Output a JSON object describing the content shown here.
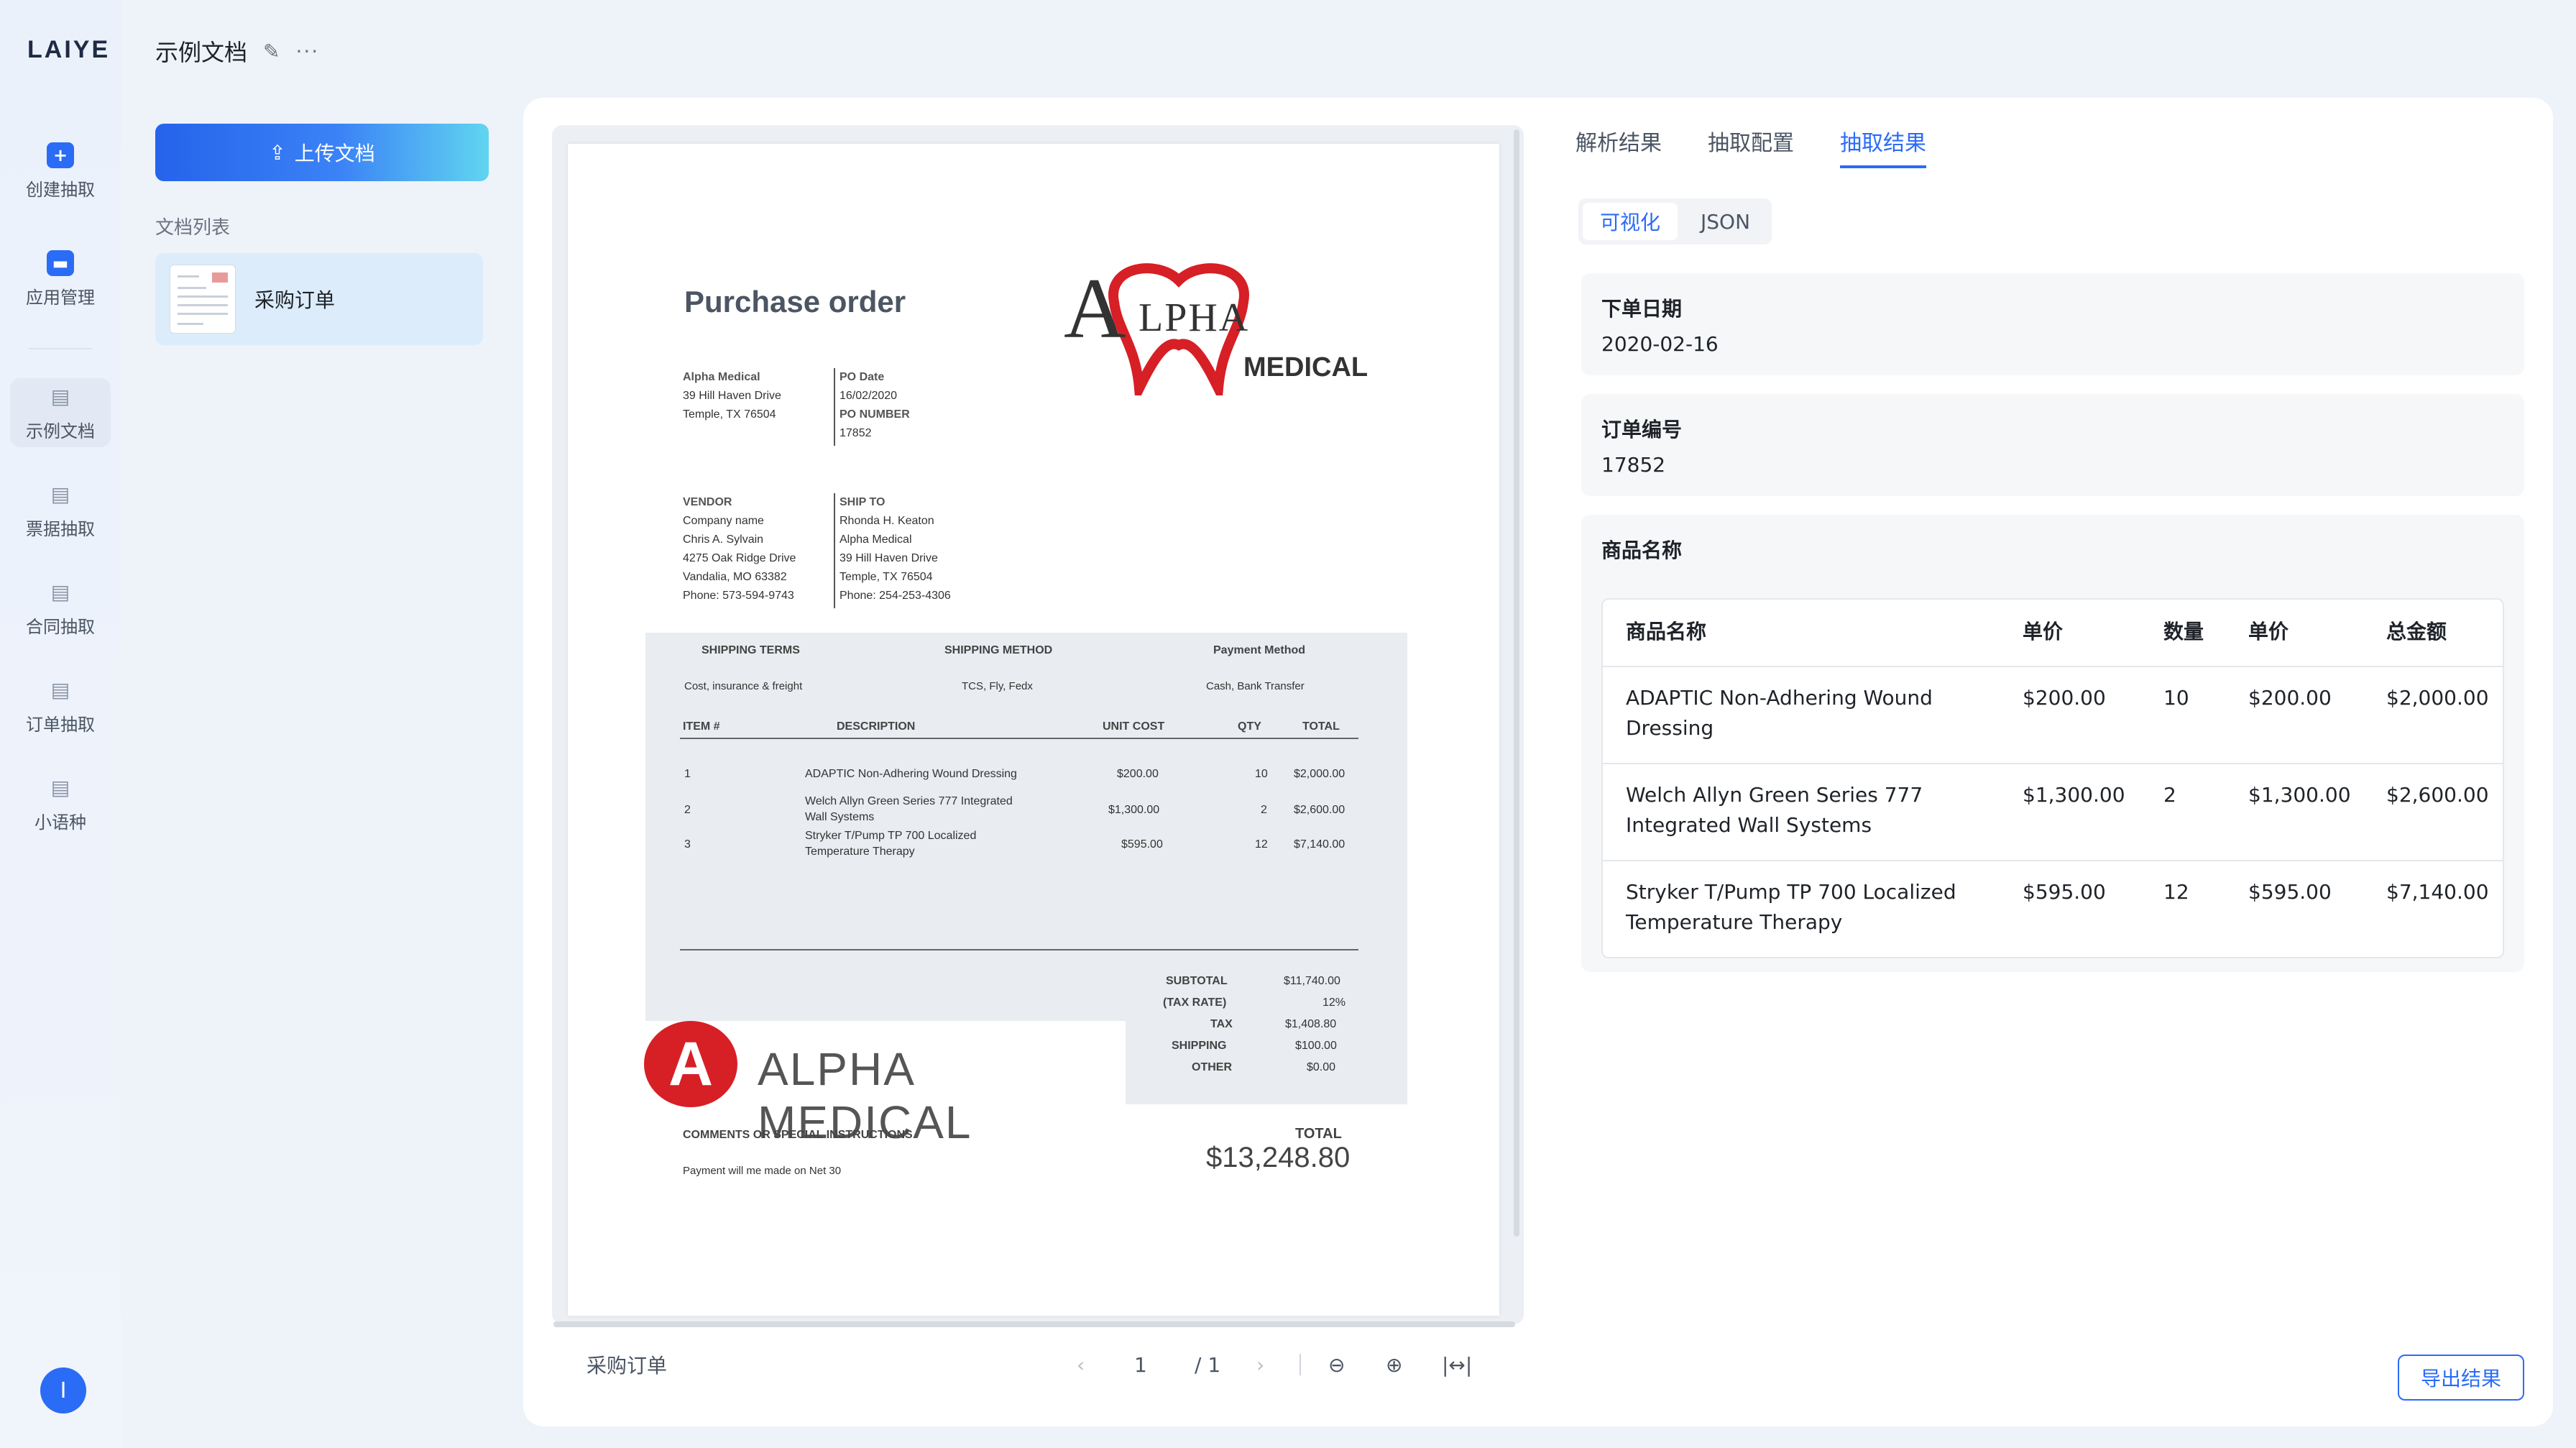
{
  "app": {
    "logo": "LAIYE"
  },
  "rail": {
    "items": [
      {
        "label": "创建抽取"
      },
      {
        "label": "应用管理"
      },
      {
        "label": "示例文档"
      },
      {
        "label": "票据抽取"
      },
      {
        "label": "合同抽取"
      },
      {
        "label": "订单抽取"
      },
      {
        "label": "小语种"
      }
    ],
    "avatar": "I"
  },
  "docpanel": {
    "title": "示例文档",
    "edit_icon": "✎",
    "more_icon": "···",
    "upload_label": "上传文档",
    "upload_icon": "⇪",
    "list_label": "文档列表",
    "items": [
      {
        "name": "采购订单"
      }
    ]
  },
  "viewer": {
    "doc_name": "采购订单",
    "prev": "‹",
    "page": "1",
    "total": "/ 1",
    "next": "›",
    "zoom_out": "⊖",
    "zoom_in": "⊕",
    "fit": "|↔|"
  },
  "po": {
    "title": "Purchase order",
    "logo_letter": "A",
    "logo_rest": "LPHA",
    "logo_sub": "MEDICAL",
    "from": [
      "Alpha Medical",
      "39 Hill Haven Drive",
      "Temple, TX 76504"
    ],
    "po_date_label": "PO Date",
    "po_date": "16/02/2020",
    "po_number_label": "PO NUMBER",
    "po_number": "17852",
    "vendor_label": "VENDOR",
    "vendor": [
      "Company name",
      "Chris A. Sylvain",
      "4275 Oak Ridge Drive",
      "Vandalia, MO 63382",
      "Phone: 573-594-9743"
    ],
    "ship_label": "SHIP TO",
    "ship": [
      "Rhonda H. Keaton",
      "Alpha Medical",
      "39 Hill Haven Drive",
      "Temple, TX 76504",
      "Phone: 254-253-4306"
    ],
    "shipping_terms_label": "SHIPPING TERMS",
    "shipping_terms": "Cost, insurance & freight",
    "shipping_method_label": "SHIPPING METHOD",
    "shipping_method": "TCS, Fly, Fedx",
    "payment_method_label": "Payment Method",
    "payment_method": "Cash, Bank Transfer",
    "col_item": "ITEM #",
    "col_desc": "DESCRIPTION",
    "col_unit": "UNIT COST",
    "col_qty": "QTY",
    "col_total": "TOTAL",
    "lines": [
      {
        "item": "1",
        "desc1": "ADAPTIC Non-Adhering Wound Dressing",
        "desc2": "",
        "unit": "$200.00",
        "qty": "10",
        "total": "$2,000.00"
      },
      {
        "item": "2",
        "desc1": "Welch Allyn Green Series 777 Integrated",
        "desc2": "Wall Systems",
        "unit": "$1,300.00",
        "qty": "2",
        "total": "$2,600.00"
      },
      {
        "item": "3",
        "desc1": "Stryker T/Pump TP 700 Localized",
        "desc2": "Temperature Therapy",
        "unit": "$595.00",
        "qty": "12",
        "total": "$7,140.00"
      }
    ],
    "subtotal_label": "SUBTOTAL",
    "subtotal": "$11,740.00",
    "taxrate_label": "(TAX RATE)",
    "taxrate": "12%",
    "tax_label": "TAX",
    "tax": "$1,408.80",
    "shipping_label": "SHIPPING",
    "shipping": "$100.00",
    "other_label": "OTHER",
    "other": "$0.00",
    "logo2_letter": "A",
    "logo2_text": "ALPHA MEDICAL",
    "comments_label": "COMMENTS OR SPECIAL INSTRUCTIONS",
    "comments": "Payment will me made on Net 30",
    "total_label": "TOTAL",
    "total": "$13,248.80"
  },
  "result": {
    "tabs": [
      "解析结果",
      "抽取配置",
      "抽取结果"
    ],
    "views": [
      "可视化",
      "JSON"
    ],
    "order_date_label": "下单日期",
    "order_date": "2020-02-16",
    "order_no_label": "订单编号",
    "order_no": "17852",
    "goods_label": "商品名称",
    "headers": [
      "商品名称",
      "单价",
      "数量",
      "单价",
      "总金额"
    ],
    "rows": [
      [
        "ADAPTIC Non-Adhering Wound Dressing",
        "$200.00",
        "10",
        "$200.00",
        "$2,000.00"
      ],
      [
        "Welch Allyn Green Series 777 Integrated Wall Systems",
        "$1,300.00",
        "2",
        "$1,300.00",
        "$2,600.00"
      ],
      [
        "Stryker T/Pump TP 700 Localized Temperature Therapy",
        "$595.00",
        "12",
        "$595.00",
        "$7,140.00"
      ]
    ],
    "export_label": "导出结果"
  },
  "colors": {
    "accent": "#2b6cf6",
    "brand_red": "#d71f26"
  }
}
